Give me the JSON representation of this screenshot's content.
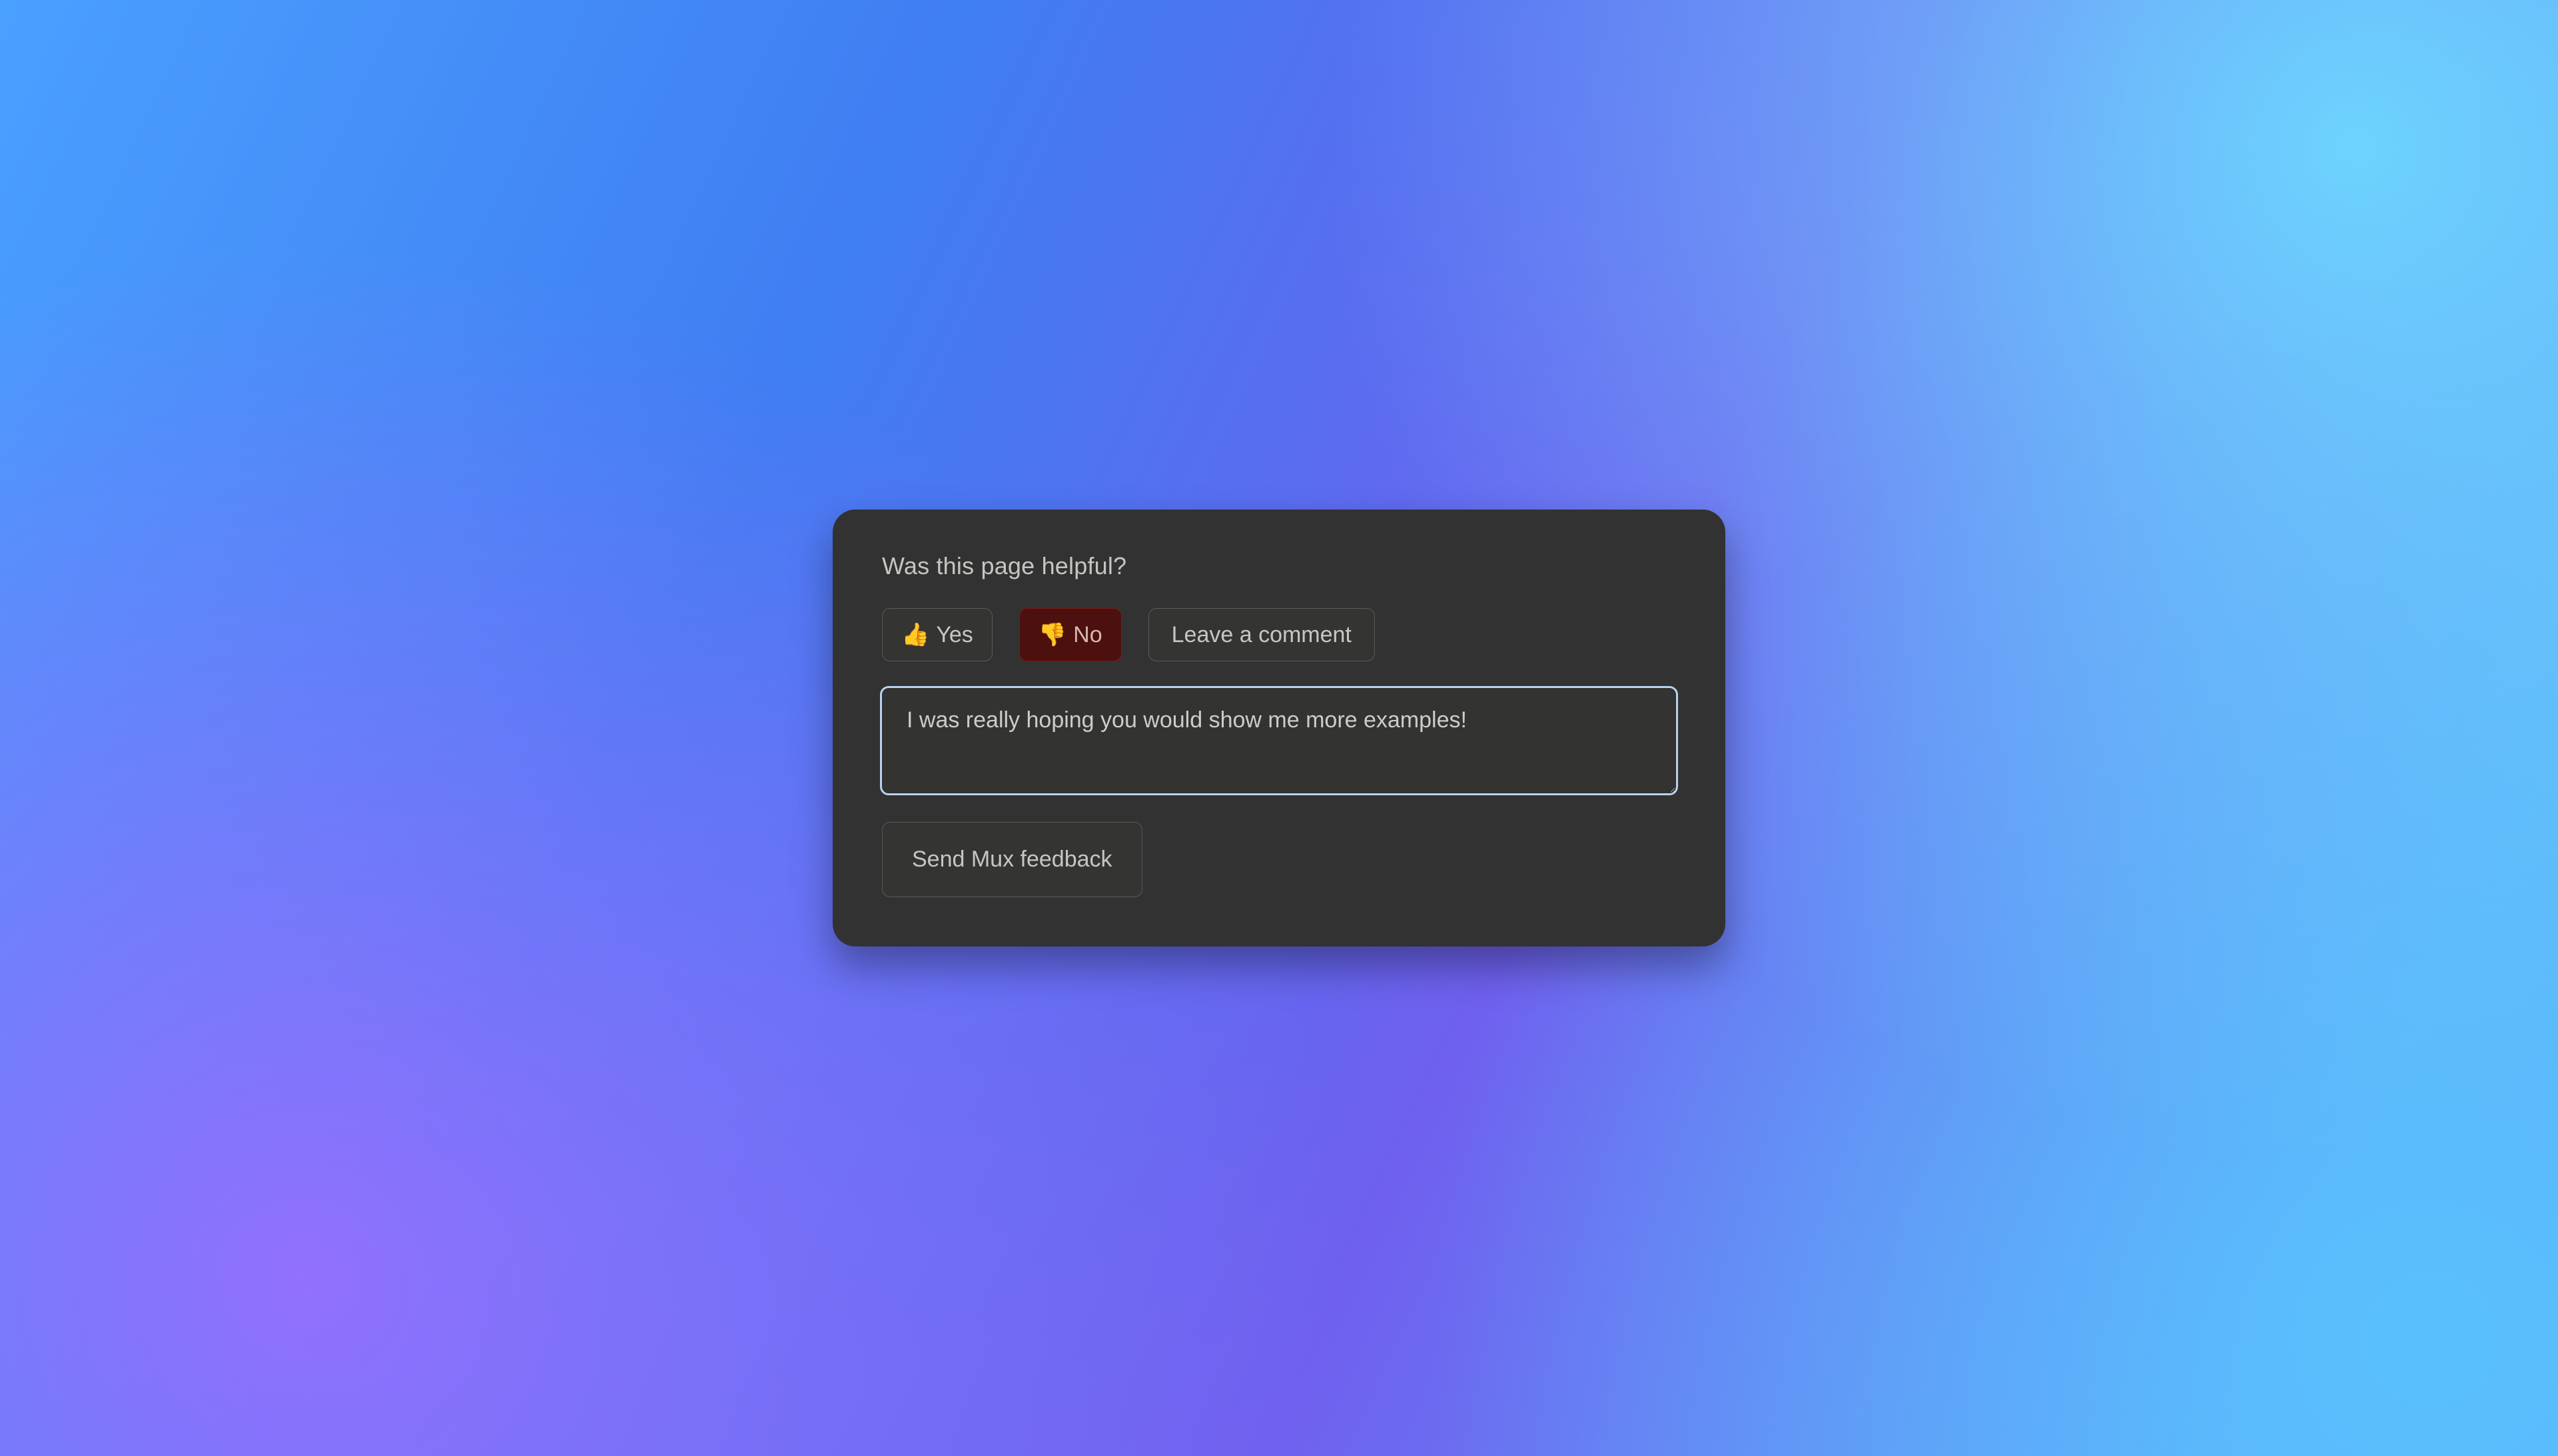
{
  "feedback": {
    "prompt": "Was this page helpful?",
    "yes": {
      "icon": "👍",
      "label": "Yes"
    },
    "no": {
      "icon": "👎",
      "label": "No",
      "selected": true
    },
    "comment_button": "Leave a comment",
    "textarea_value": "I was really hoping you would show me more examples!",
    "submit_label": "Send Mux feedback"
  }
}
